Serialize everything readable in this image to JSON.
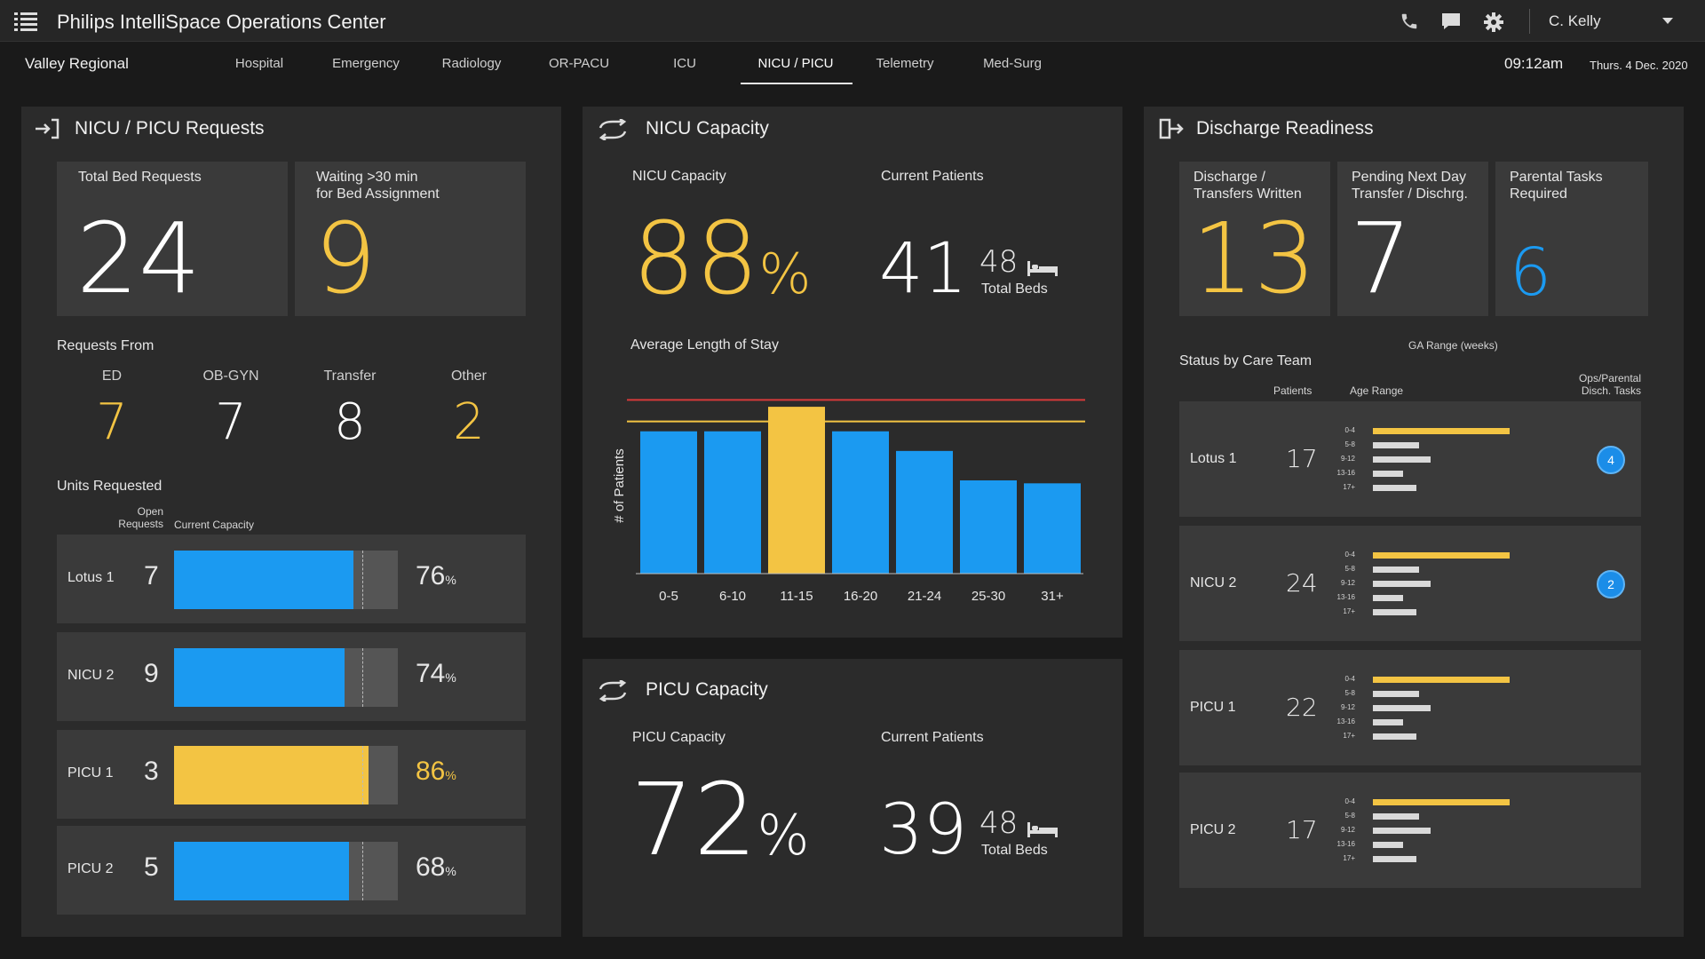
{
  "app": {
    "title": "Philips IntelliSpace Operations Center",
    "user": "C. Kelly"
  },
  "nav": {
    "facility": "Valley Regional",
    "tabs": [
      "Hospital",
      "Emergency",
      "Radiology",
      "OR-PACU",
      "ICU",
      "NICU / PICU",
      "Telemetry",
      "Med-Surg"
    ],
    "active_tab": "NICU / PICU",
    "time": "09:12am",
    "date": "Thurs. 4 Dec. 2020"
  },
  "colors": {
    "yellow": "#f3c443",
    "blue": "#1b9af1",
    "red": "#d63a3a",
    "panel": "#2b2b2b",
    "card": "#3a3a3a"
  },
  "requests": {
    "title": "NICU / PICU Requests",
    "total_label": "Total Bed Requests",
    "total_value": "24",
    "waiting_label": "Waiting >30 min\nfor Bed Assignment",
    "waiting_value": "9",
    "from_label": "Requests From",
    "from": [
      {
        "label": "ED",
        "value": "7"
      },
      {
        "label": "OB-GYN",
        "value": "7"
      },
      {
        "label": "Transfer",
        "value": "8"
      },
      {
        "label": "Other",
        "value": "2"
      }
    ],
    "units_label": "Units Requested",
    "open_requests_label": "Open\nRequests",
    "current_capacity_label": "Current Capacity",
    "units": [
      {
        "name": "Lotus 1",
        "open": "7",
        "pct_text": "76",
        "pct": 0.8,
        "highlight": false
      },
      {
        "name": "NICU 2",
        "open": "9",
        "pct_text": "74",
        "pct": 0.76,
        "highlight": false
      },
      {
        "name": "PICU 1",
        "open": "3",
        "pct_text": "86",
        "pct": 0.87,
        "highlight": true
      },
      {
        "name": "PICU 2",
        "open": "5",
        "pct_text": "68",
        "pct": 0.78,
        "highlight": false
      }
    ],
    "unit_threshold": 0.84,
    "pct_suffix": "%"
  },
  "nicu": {
    "title": "NICU Capacity",
    "capacity_label": "NICU Capacity",
    "capacity_value": "88",
    "pct_sign": "%",
    "patients_label": "Current Patients",
    "patients_value": "41",
    "total_beds_value": "48",
    "total_beds_label": "Total Beds",
    "chart_title": "Average Length of Stay",
    "y_axis_label": "# of Patients"
  },
  "chart_data": {
    "type": "bar",
    "title": "Average Length of Stay",
    "xlabel": "",
    "ylabel": "# of Patients",
    "categories": [
      "0-5",
      "6-10",
      "11-15",
      "16-20",
      "21-24",
      "25-30",
      "31+"
    ],
    "values": [
      145,
      145,
      170,
      145,
      125,
      95,
      92
    ],
    "highlight_index": 2,
    "ylim": [
      0,
      190
    ],
    "threshold_lines": [
      {
        "value": 177,
        "color": "#d63a3a"
      },
      {
        "value": 155,
        "color": "#f3c443"
      }
    ]
  },
  "picu": {
    "title": "PICU Capacity",
    "capacity_label": "PICU Capacity",
    "capacity_value": "72",
    "pct_sign": "%",
    "patients_label": "Current Patients",
    "patients_value": "39",
    "total_beds_value": "48",
    "total_beds_label": "Total Beds"
  },
  "discharge": {
    "title": "Discharge Readiness",
    "cards": [
      {
        "label": "Discharge /\nTransfers Written",
        "value": "13",
        "color": "yellow"
      },
      {
        "label": "Pending Next Day\nTransfer / Dischrg.",
        "value": "7",
        "color": "white"
      },
      {
        "label": "Parental Tasks\nRequired",
        "value": "6",
        "color": "blue"
      }
    ],
    "ga_range_label": "GA Range (weeks)",
    "status_label": "Status by Care Team",
    "col_patients": "Patients",
    "col_age": "Age Range",
    "col_tasks": "Ops/Parental\nDisch. Tasks",
    "age_labels": [
      "0-4",
      "5-8",
      "9-12",
      "13-16",
      "17+"
    ],
    "teams": [
      {
        "name": "Lotus 1",
        "patients": "17",
        "bars": [
          1.0,
          0.34,
          0.42,
          0.22,
          0.32
        ],
        "tasks": "4"
      },
      {
        "name": "NICU 2",
        "patients": "24",
        "bars": [
          1.0,
          0.34,
          0.42,
          0.22,
          0.32
        ],
        "tasks": "2"
      },
      {
        "name": "PICU 1",
        "patients": "22",
        "bars": [
          1.0,
          0.34,
          0.42,
          0.22,
          0.32
        ],
        "tasks": ""
      },
      {
        "name": "PICU 2",
        "patients": "17",
        "bars": [
          1.0,
          0.34,
          0.42,
          0.22,
          0.32
        ],
        "tasks": ""
      }
    ]
  }
}
